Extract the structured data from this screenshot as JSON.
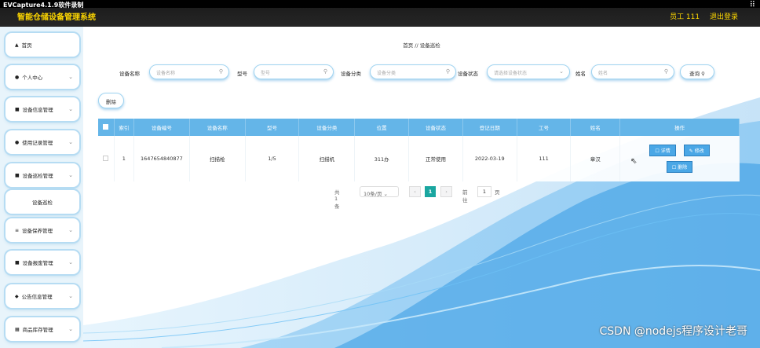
{
  "recorder": {
    "caption": "EVCapture4.1.9软件录制"
  },
  "app": {
    "title": "智能仓储设备管理系统",
    "user_label": "员工 111",
    "logout_label": "退出登录"
  },
  "sidebar": {
    "items": [
      {
        "label": "首页",
        "icon": "home-icon",
        "has_chevron": false
      },
      {
        "label": "个人中心",
        "icon": "user-icon",
        "has_chevron": true
      },
      {
        "label": "设备信息管理",
        "icon": "info-icon",
        "has_chevron": true
      },
      {
        "label": "使用记录管理",
        "icon": "record-icon",
        "has_chevron": true
      },
      {
        "label": "设备巡检管理",
        "icon": "inspect-icon",
        "has_chevron": true
      },
      {
        "label": "设备巡检",
        "icon": "",
        "has_chevron": false
      },
      {
        "label": "设备保养管理",
        "icon": "list-icon",
        "has_chevron": true
      },
      {
        "label": "设备报废管理",
        "icon": "scrap-icon",
        "has_chevron": true
      },
      {
        "label": "公告信息管理",
        "icon": "notice-icon",
        "has_chevron": true
      },
      {
        "label": "商品库存管理",
        "icon": "grid-icon",
        "has_chevron": true
      }
    ]
  },
  "breadcrumb": {
    "home": "首页",
    "separator": "//",
    "current": "设备巡检"
  },
  "filters": {
    "name_label": "设备名称",
    "name_placeholder": "设备名称",
    "model_label": "型号",
    "model_placeholder": "型号",
    "category_label": "设备分类",
    "category_placeholder": "设备分类",
    "status_label": "设备状态",
    "status_placeholder": "请选择设备状态",
    "staff_label": "姓名",
    "staff_placeholder": "姓名",
    "search_label": "查询"
  },
  "toolbar": {
    "delete_label": "删除"
  },
  "table": {
    "headers": [
      "索引",
      "设备编号",
      "设备名称",
      "型号",
      "设备分类",
      "位置",
      "设备状态",
      "登记日期",
      "工号",
      "姓名",
      "操作"
    ],
    "rows": [
      {
        "cells": [
          "1",
          "1647654840877",
          "扫描枪",
          "1/5",
          "扫描机",
          "311办",
          "正常使用",
          "2022-03-19",
          "111",
          "章汉"
        ]
      }
    ],
    "actions": {
      "detail": "详情",
      "edit": "修改",
      "delete": "删除"
    }
  },
  "pagination": {
    "total": "共1条",
    "page_size": "10条/页",
    "current": "1",
    "goto_label": "前往",
    "goto_value": "1",
    "page_suffix": "页"
  },
  "watermark": "CSDN @nodejs程序设计老哥",
  "colors": {
    "header": "#64b5e8",
    "accent": "#4aa7e6",
    "title": "#ffd800",
    "page_active": "#1aa6a0"
  }
}
